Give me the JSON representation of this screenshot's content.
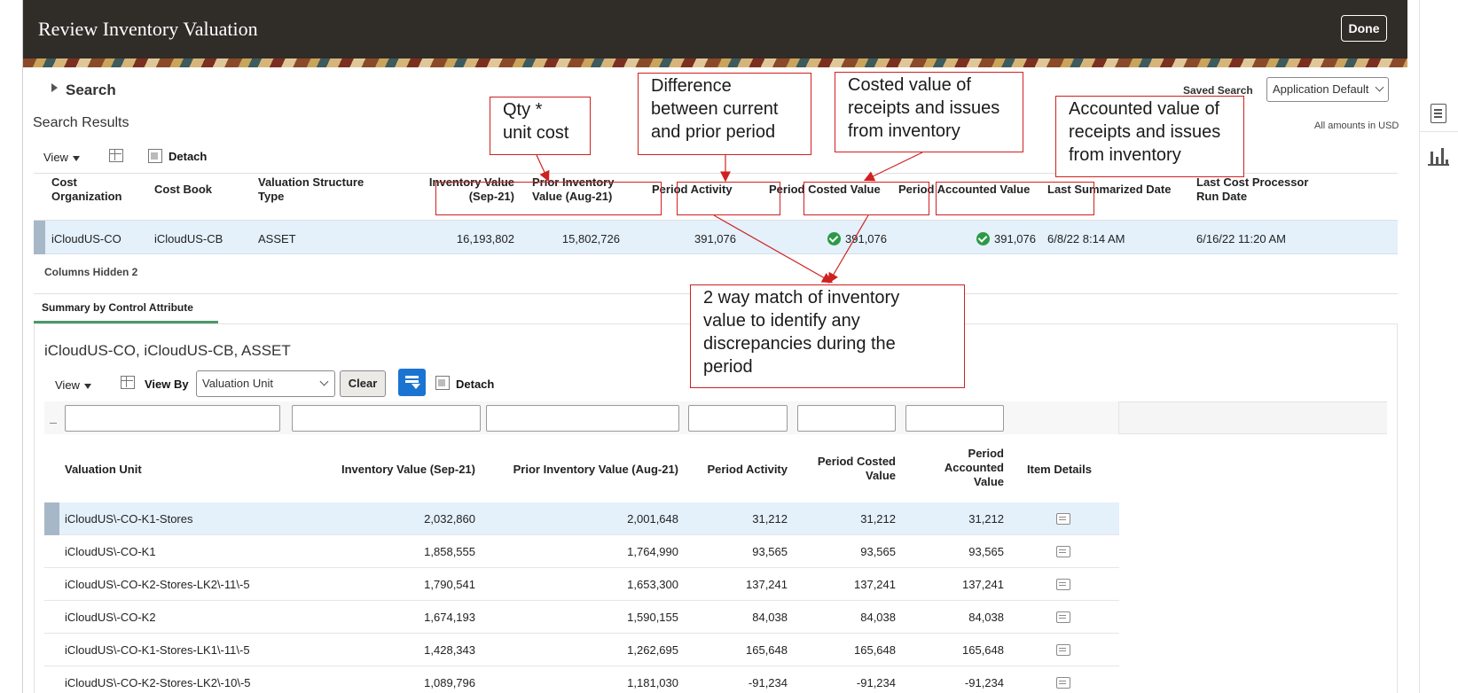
{
  "header": {
    "title": "Review Inventory Valuation",
    "done_label": "Done"
  },
  "search": {
    "label": "Search",
    "saved_search_label": "Saved Search",
    "saved_search_value": "Application Default",
    "results_label": "Search Results",
    "amounts_note": "All amounts in USD"
  },
  "toolbar": {
    "view_label": "View",
    "detach_label": "Detach"
  },
  "main_table": {
    "headers": {
      "cost_org": [
        "Cost",
        "Organization"
      ],
      "cost_book": "Cost Book",
      "val_struct": [
        "Valuation Structure",
        "Type"
      ],
      "inv_value": [
        "Inventory Value",
        "(Sep-21)"
      ],
      "prior_value": [
        "Prior Inventory",
        "Value (Aug-21)"
      ],
      "period_activity": "Period Activity",
      "period_costed": "Period Costed Value",
      "period_accounted": "Period Accounted Value",
      "last_summarized": "Last Summarized Date",
      "last_cost_run": [
        "Last Cost Processor",
        "Run Date"
      ]
    },
    "row": {
      "cost_org": "iCloudUS-CO",
      "cost_book": "iCloudUS-CB",
      "val_struct": "ASSET",
      "inv_value": "16,193,802",
      "prior_value": "15,802,726",
      "period_activity": "391,076",
      "period_costed": "391,076",
      "period_accounted": "391,076",
      "last_summarized": "6/8/22 8:14 AM",
      "last_cost_run": "6/16/22 11:20 AM"
    },
    "columns_hidden": "Columns Hidden  2"
  },
  "summary": {
    "tab_label": "Summary by Control Attribute",
    "heading": "iCloudUS-CO, iCloudUS-CB, ASSET",
    "view_label": "View",
    "view_by_label": "View By",
    "view_by_value": "Valuation Unit",
    "clear_label": "Clear",
    "detach_label": "Detach",
    "headers": {
      "valuation_unit": "Valuation Unit",
      "inv_value": "Inventory Value (Sep-21)",
      "prior_value": "Prior Inventory Value (Aug-21)",
      "period_activity": "Period Activity",
      "period_costed": [
        "Period Costed",
        "Value"
      ],
      "period_accounted": [
        "Period",
        "Accounted",
        "Value"
      ],
      "item_details": "Item Details"
    },
    "rows": [
      {
        "unit": "iCloudUS\\-CO-K1-Stores",
        "inv": "2,032,860",
        "prior": "2,001,648",
        "activity": "31,212",
        "costed": "31,212",
        "accounted": "31,212"
      },
      {
        "unit": "iCloudUS\\-CO-K1",
        "inv": "1,858,555",
        "prior": "1,764,990",
        "activity": "93,565",
        "costed": "93,565",
        "accounted": "93,565"
      },
      {
        "unit": "iCloudUS\\-CO-K2-Stores-LK2\\-11\\-5",
        "inv": "1,790,541",
        "prior": "1,653,300",
        "activity": "137,241",
        "costed": "137,241",
        "accounted": "137,241"
      },
      {
        "unit": "iCloudUS\\-CO-K2",
        "inv": "1,674,193",
        "prior": "1,590,155",
        "activity": "84,038",
        "costed": "84,038",
        "accounted": "84,038"
      },
      {
        "unit": "iCloudUS\\-CO-K1-Stores-LK1\\-11\\-5",
        "inv": "1,428,343",
        "prior": "1,262,695",
        "activity": "165,648",
        "costed": "165,648",
        "accounted": "165,648"
      },
      {
        "unit": "iCloudUS\\-CO-K2-Stores-LK2\\-10\\-5",
        "inv": "1,089,796",
        "prior": "1,181,030",
        "activity": "-91,234",
        "costed": "-91,234",
        "accounted": "-91,234"
      }
    ]
  },
  "annotations": {
    "qty": [
      "Qty *",
      "unit cost"
    ],
    "difference": [
      "Difference",
      "between current",
      "and prior period"
    ],
    "costed": [
      "Costed value of",
      "receipts and issues",
      "from inventory"
    ],
    "accounted": [
      "Accounted value of",
      "receipts and issues",
      "from inventory"
    ],
    "match": [
      "2 way match of inventory",
      "value to identify any",
      "discrepancies during the",
      "period"
    ]
  },
  "colors": {
    "header_bg": "#302c28",
    "selected_row": "#e4f0fa",
    "annotation_red": "#d02020",
    "accent_blue": "#1a74d2",
    "check_green": "#2a9a45"
  }
}
